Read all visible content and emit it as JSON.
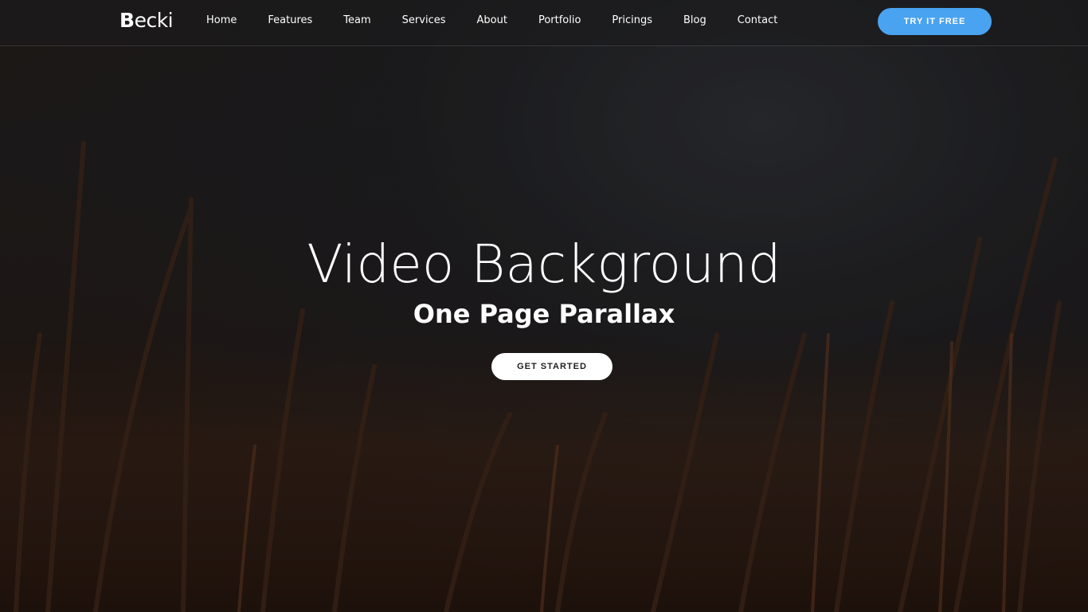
{
  "brand": {
    "logo_first": "B",
    "logo_rest": "ecki"
  },
  "nav": {
    "items": [
      {
        "label": "Home"
      },
      {
        "label": "Features"
      },
      {
        "label": "Team"
      },
      {
        "label": "Services"
      },
      {
        "label": "About"
      },
      {
        "label": "Portfolio"
      },
      {
        "label": "Pricings"
      },
      {
        "label": "Blog"
      },
      {
        "label": "Contact"
      }
    ],
    "cta_label": "TRY IT FREE"
  },
  "hero": {
    "title": "Video Background",
    "subtitle": "One Page Parallax",
    "cta_label": "GET STARTED"
  },
  "colors": {
    "accent": "#4aa3f0",
    "hero_button_bg": "#ffffff",
    "text": "#ffffff"
  }
}
